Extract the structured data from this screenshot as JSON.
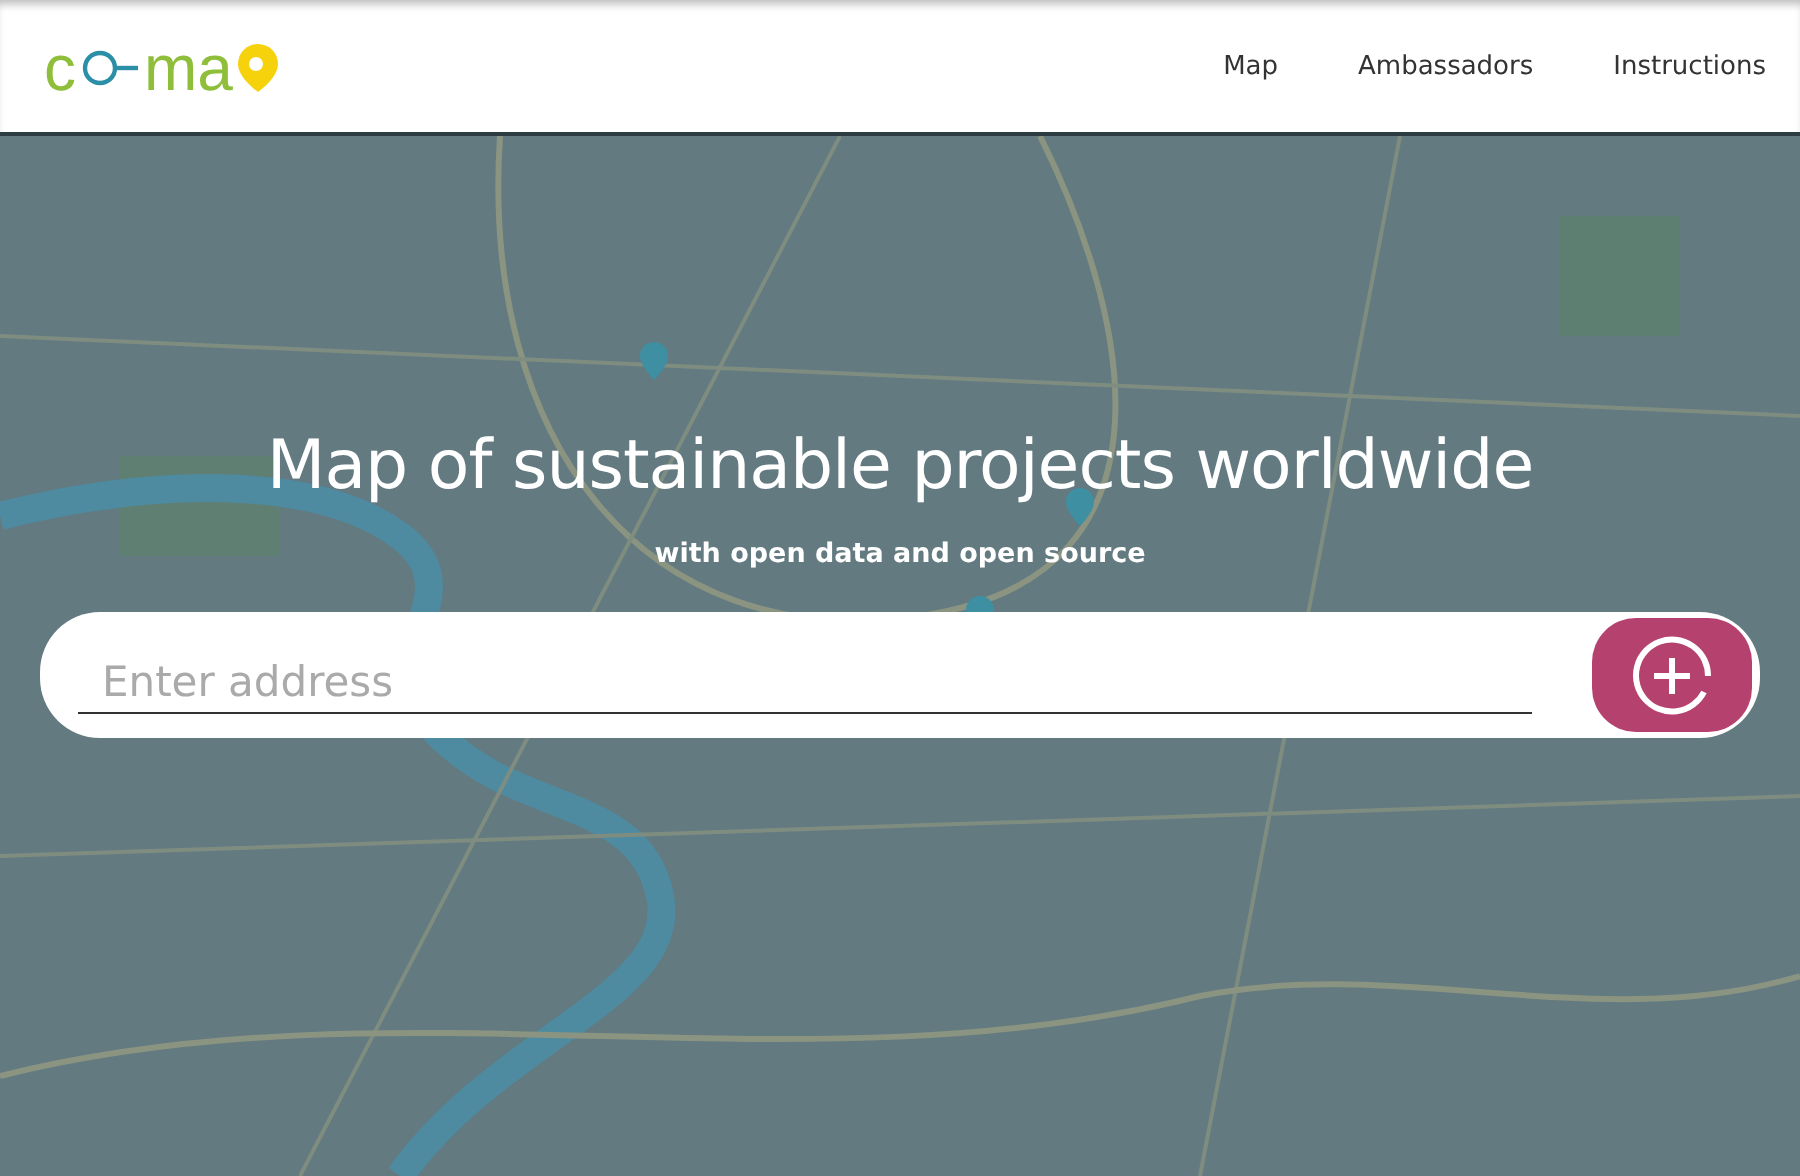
{
  "logo": {
    "parts": [
      "c",
      "ma"
    ]
  },
  "nav": [
    {
      "label": "Map"
    },
    {
      "label": "Ambassadors"
    },
    {
      "label": "Instructions"
    }
  ],
  "hero": {
    "title": "Map of sustainable projects worldwide",
    "subtitle": "with open data and open source"
  },
  "search": {
    "placeholder": "Enter address"
  }
}
